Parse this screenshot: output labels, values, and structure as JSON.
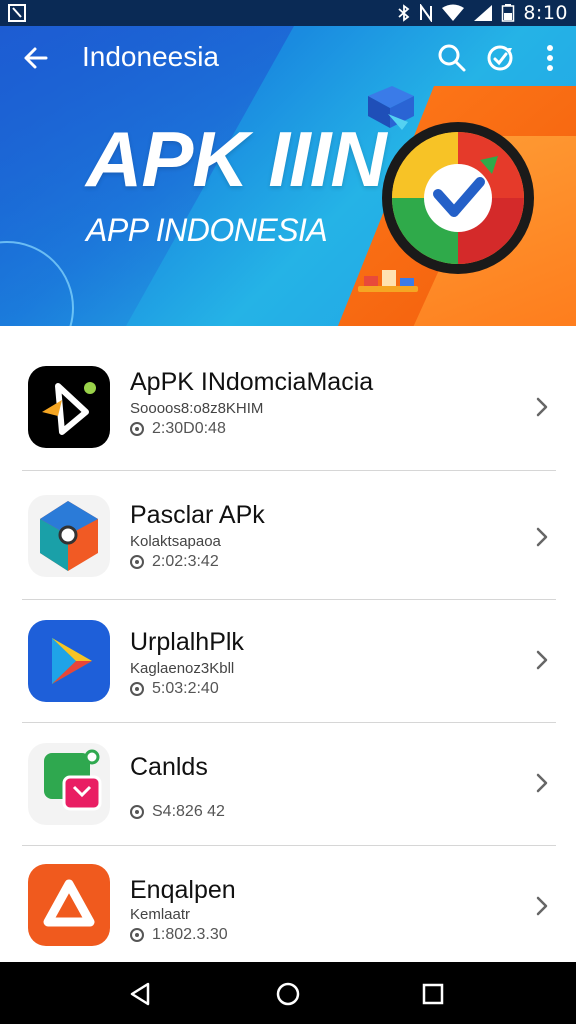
{
  "status_bar": {
    "time": "8:10",
    "icons": [
      "notification-icon",
      "bluetooth-icon",
      "nfc-icon",
      "wifi-icon",
      "signal-icon",
      "battery-icon"
    ]
  },
  "app_bar": {
    "title": "Indoneesia",
    "back_icon": "arrow-back-icon",
    "actions": [
      "search-icon",
      "refresh-icon",
      "more-vert-icon"
    ]
  },
  "banner": {
    "title": "APK IIIN",
    "subtitle": "APP INDONESIA"
  },
  "apps": [
    {
      "name": "ApPK INdomciaMacia",
      "subtitle": "Soooos8:o8z8KHIM",
      "meta": "2:30D0:48",
      "icon": "app-icon-dark"
    },
    {
      "name": "Pasclar APk",
      "subtitle": "Kolaktsapaoa",
      "meta": "2:02:3:42",
      "icon": "app-icon-cube"
    },
    {
      "name": "UrplalhPlk",
      "subtitle": "Kaglaenoz3Kbll",
      "meta": "5:03:2:40",
      "icon": "app-icon-play"
    },
    {
      "name": "Canlds",
      "subtitle": "",
      "meta": "S4:826 42",
      "icon": "app-icon-green"
    },
    {
      "name": "Enqalpen",
      "subtitle": "Kemlaatr",
      "meta": "1:802.3.30",
      "icon": "app-icon-orange"
    }
  ],
  "nav_bar": {
    "buttons": [
      "back-triangle-icon",
      "home-circle-icon",
      "recents-square-icon"
    ]
  },
  "colors": {
    "status_bar": "#0a2a55",
    "banner_blue": "#1a8be0",
    "banner_orange": "#ff7a1a",
    "nav_bar": "#000000"
  }
}
